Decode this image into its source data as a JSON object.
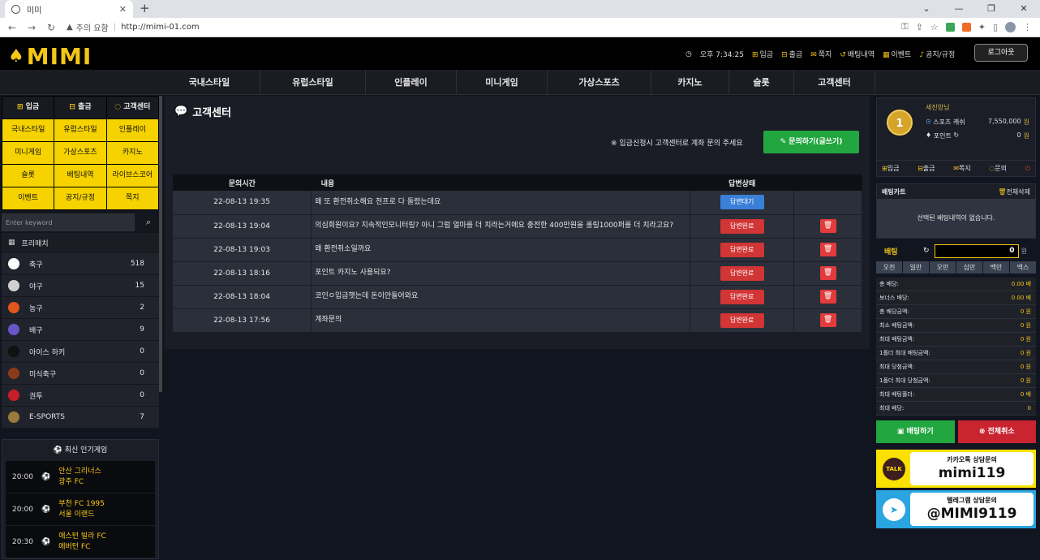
{
  "browser": {
    "tab_title": "미미",
    "url_warning": "주의 요함",
    "url": "http://mimi-01.com"
  },
  "header": {
    "logo": "MIMI",
    "time": "오후 7:34:25",
    "menu": [
      "입금",
      "출금",
      "쪽지",
      "배팅내역",
      "이벤트",
      "공지/규정"
    ],
    "logout": "로그아웃"
  },
  "nav": [
    "국내스타일",
    "유럽스타일",
    "인플레이",
    "미니게임",
    "가상스포츠",
    "카지노",
    "슬롯",
    "고객센터"
  ],
  "left": {
    "grid_head": [
      "입금",
      "출금",
      "고객센터"
    ],
    "grid": [
      "국내스타일",
      "유럽스타일",
      "인플레이",
      "미니게임",
      "가상스포츠",
      "카지노",
      "슬롯",
      "배팅내역",
      "라이브스코어",
      "이벤트",
      "공지/규정",
      "쪽지"
    ],
    "search_placeholder": "Enter keyword",
    "match_label": "프리매치",
    "sports": [
      {
        "name": "축구",
        "count": "518",
        "color": "#ffffff"
      },
      {
        "name": "야구",
        "count": "15",
        "color": "#d0d0d0"
      },
      {
        "name": "농구",
        "count": "2",
        "color": "#e0561c"
      },
      {
        "name": "배구",
        "count": "9",
        "color": "#6a55c8"
      },
      {
        "name": "아이스 하키",
        "count": "0",
        "color": "#111111"
      },
      {
        "name": "미식축구",
        "count": "0",
        "color": "#8a3b1a"
      },
      {
        "name": "권투",
        "count": "0",
        "color": "#c81e2a"
      },
      {
        "name": "E-SPORTS",
        "count": "7",
        "color": "#9a7a3a"
      }
    ],
    "popular_title": "최신 인기게임",
    "games": [
      {
        "time": "20:00",
        "home": "안산 그리너스",
        "away": "광주 FC"
      },
      {
        "time": "20:00",
        "home": "부천 FC 1995",
        "away": "서울 이랜드"
      },
      {
        "time": "20:30",
        "home": "애스턴 빌라 FC",
        "away": "에버턴 FC"
      }
    ]
  },
  "center": {
    "title": "고객센터",
    "notice": "※ 입금신청시 고객센터로 계좌 문의 주세요",
    "write_btn": "문의하기(글쓰기)",
    "headers": [
      "문의시간",
      "내용",
      "답변상태",
      ""
    ],
    "rows": [
      {
        "time": "22-08-13 19:35",
        "content": "왜 또 환전취소해요 천프로 다 돌렸는데요",
        "status": "답변대기",
        "state": "wait"
      },
      {
        "time": "22-08-13 19:04",
        "content": "의심회원이요? 지속적인모니터링? 아니 그럼 얼마를 더 치라는거에요 충전한 400만원을 롤링1000퍼를 더 치라고요?",
        "status": "답변완료",
        "state": "done"
      },
      {
        "time": "22-08-13 19:03",
        "content": "왜 환전취소일까요",
        "status": "답변완료",
        "state": "done"
      },
      {
        "time": "22-08-13 18:16",
        "content": "포인트 카지노 사용되요?",
        "status": "답변완료",
        "state": "done"
      },
      {
        "time": "22-08-13 18:04",
        "content": "코인ㅇ입금햇는데 돈이안들어와요",
        "status": "답변완료",
        "state": "done"
      },
      {
        "time": "22-08-13 17:56",
        "content": "계좌문의",
        "status": "답변완료",
        "state": "done"
      }
    ]
  },
  "right": {
    "medal": "1",
    "user": "세진양님",
    "cash_label": "스포츠 캐쉬",
    "cash": "7,550,000",
    "point_label": "포인트",
    "point": "0",
    "unit": "원",
    "buttons": [
      "입금",
      "출금",
      "쪽지",
      "문의"
    ],
    "cart_title": "배팅카트",
    "cart_clear": "전체삭제",
    "cart_empty": "선택된 배팅내역이 없습니다.",
    "bet_label": "배팅",
    "bet_value": "0",
    "bet_unit": "원",
    "chips": [
      "오천",
      "일만",
      "오만",
      "십만",
      "백만",
      "맥스"
    ],
    "calc": [
      {
        "k": "총 배당:",
        "v": "0.00 배"
      },
      {
        "k": "보너스 배당:",
        "v": "0.00 배"
      },
      {
        "k": "총 배당금액:",
        "v": "0 원"
      },
      {
        "k": "최소 배팅금액:",
        "v": "0 원"
      },
      {
        "k": "최대 배팅금액:",
        "v": "0 원"
      },
      {
        "k": "1폴더 최대 배팅금액:",
        "v": "0 원"
      },
      {
        "k": "최대 당첨금액:",
        "v": "0 원"
      },
      {
        "k": "1폴더 최대 당첨금액:",
        "v": "0 원"
      },
      {
        "k": "최대 배팅폴더:",
        "v": "0 배"
      },
      {
        "k": "최대 배당:",
        "v": "0"
      }
    ],
    "bet_btn": "배팅하기",
    "cancel_btn": "전체취소",
    "kakao_label": "카카오톡 상담문의",
    "kakao_id": "mimi119",
    "kakao_icon": "TALK",
    "tg_label": "텔레그램 상담문의",
    "tg_id": "@MIMI9119"
  },
  "colors": {
    "accent": "#f5c518",
    "green": "#22a640",
    "red": "#d13535",
    "blue": "#3a7fd8"
  }
}
